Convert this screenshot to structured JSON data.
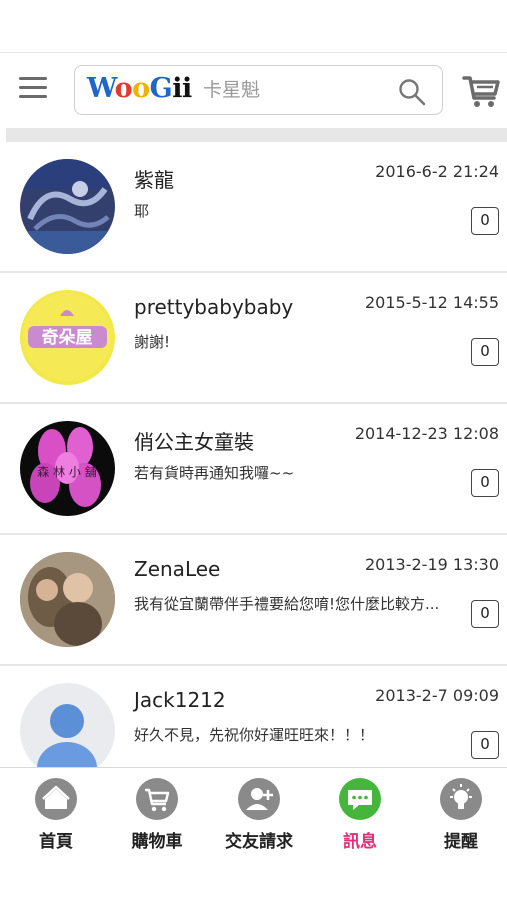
{
  "header": {
    "logo_text": "WooGi",
    "search_placeholder": "卡星魁"
  },
  "messages": [
    {
      "name": "紫龍",
      "time": "2016-6-2 21:24",
      "message": "耶",
      "count": "0"
    },
    {
      "name": "prettybabybaby",
      "time": "2015-5-12 14:55",
      "message": "謝謝!",
      "count": "0"
    },
    {
      "name": "俏公主女童裝",
      "time": "2014-12-23 12:08",
      "message": "若有貨時再通知我囉~~",
      "count": "0"
    },
    {
      "name": "ZenaLee",
      "time": "2013-2-19 13:30",
      "message": "我有從宜蘭帶伴手禮要給您唷!您什麼比較方...",
      "count": "0"
    },
    {
      "name": "Jack1212",
      "time": "2013-2-7 09:09",
      "message": "好久不見，先祝你好運旺旺來！！！",
      "count": "0"
    }
  ],
  "tabs": [
    {
      "label": "首頁",
      "icon": "home-icon"
    },
    {
      "label": "購物車",
      "icon": "cart-icon"
    },
    {
      "label": "交友請求",
      "icon": "add-friend-icon"
    },
    {
      "label": "訊息",
      "icon": "message-icon"
    },
    {
      "label": "提醒",
      "icon": "lightbulb-icon"
    }
  ],
  "active_tab": "訊息",
  "colors": {
    "active_tab_icon": "#45b53b",
    "active_tab_label": "#e0307a",
    "inactive_tab_icon": "#8a8a8a"
  }
}
